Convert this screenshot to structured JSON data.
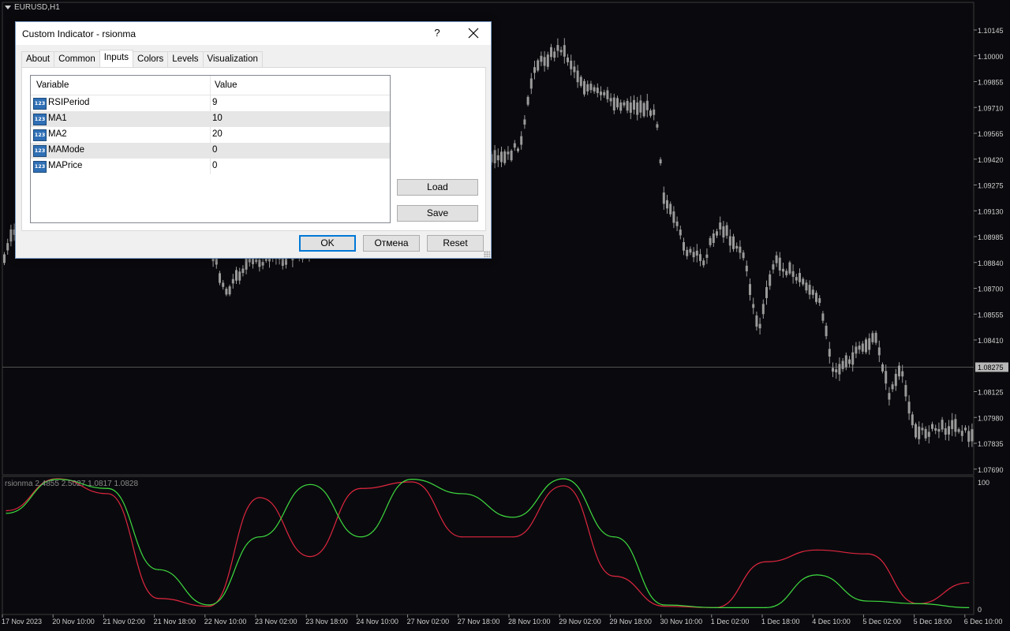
{
  "chart": {
    "symbol": "EURUSD,H1",
    "indicator_line": "rsionma 2.4855 2.5027 1.0817 1.0828",
    "price_ticks": [
      "1.10145",
      "1.10000",
      "1.09855",
      "1.09710",
      "1.09565",
      "1.09420",
      "1.09275",
      "1.09130",
      "1.08985",
      "1.08840",
      "1.08700",
      "1.08555",
      "1.08410",
      "1.08275",
      "1.08125",
      "1.07980",
      "1.07835",
      "1.07690"
    ],
    "current_price": "1.08275",
    "indicator_ticks": [
      "100",
      "0"
    ],
    "time_ticks": [
      "17 Nov 2023",
      "20 Nov 10:00",
      "21 Nov 02:00",
      "21 Nov 18:00",
      "22 Nov 10:00",
      "23 Nov 02:00",
      "23 Nov 18:00",
      "24 Nov 10:00",
      "27 Nov 02:00",
      "27 Nov 18:00",
      "28 Nov 10:00",
      "29 Nov 02:00",
      "29 Nov 18:00",
      "30 Nov 10:00",
      "1 Dec 02:00",
      "1 Dec 18:00",
      "4 Dec 10:00",
      "5 Dec 02:00",
      "5 Dec 18:00",
      "6 Dec 10:00"
    ],
    "colors": {
      "background": "#0a0a0e",
      "candles": "#9a9a9a",
      "line_red": "#e0263f",
      "line_green": "#3fdc3f",
      "axis_text": "#cfcfcf"
    }
  },
  "chart_data": {
    "type": "line",
    "title": "rsionma 2.4855 2.5027 1.0817 1.0828",
    "ylim": [
      0,
      100
    ],
    "x": [
      "17 Nov 2023",
      "20 Nov 10:00",
      "21 Nov 02:00",
      "21 Nov 18:00",
      "22 Nov 10:00",
      "23 Nov 02:00",
      "23 Nov 18:00",
      "24 Nov 10:00",
      "27 Nov 02:00",
      "27 Nov 18:00",
      "28 Nov 10:00",
      "29 Nov 02:00",
      "29 Nov 18:00",
      "30 Nov 10:00",
      "1 Dec 02:00",
      "1 Dec 18:00",
      "4 Dec 10:00",
      "5 Dec 02:00",
      "5 Dec 18:00",
      "6 Dec 10:00"
    ],
    "series": [
      {
        "color": "#e0263f",
        "values": [
          75,
          100,
          88,
          8,
          2,
          85,
          40,
          92,
          97,
          55,
          55,
          94,
          25,
          2,
          1,
          36,
          45,
          42,
          4,
          20
        ]
      },
      {
        "color": "#3fdc3f",
        "values": [
          73,
          99,
          92,
          30,
          3,
          55,
          95,
          55,
          99,
          88,
          70,
          100,
          55,
          3,
          1,
          1,
          26,
          6,
          4,
          1
        ]
      }
    ]
  },
  "dialog": {
    "title": "Custom Indicator - rsionma",
    "help": "?",
    "tabs": [
      "About",
      "Common",
      "Inputs",
      "Colors",
      "Levels",
      "Visualization"
    ],
    "active_tab": "Inputs",
    "columns": {
      "variable": "Variable",
      "value": "Value"
    },
    "param_icon": "123",
    "params": [
      {
        "name": "RSIPeriod",
        "value": "9"
      },
      {
        "name": "MA1",
        "value": "10"
      },
      {
        "name": "MA2",
        "value": "20"
      },
      {
        "name": "MAMode",
        "value": "0"
      },
      {
        "name": "MAPrice",
        "value": "0"
      }
    ],
    "buttons": {
      "load": "Load",
      "save": "Save",
      "ok": "OK",
      "cancel": "Отмена",
      "reset": "Reset"
    }
  }
}
